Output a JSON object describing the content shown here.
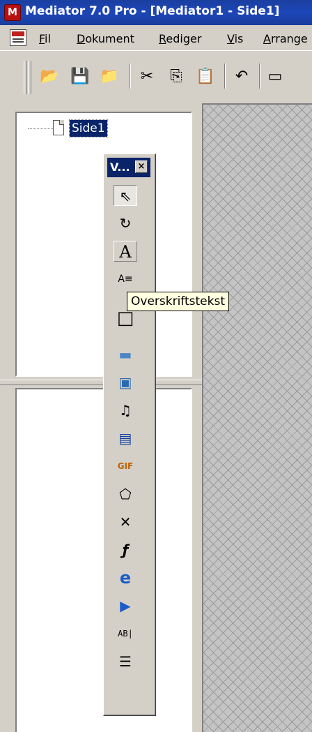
{
  "window": {
    "title": "Mediator 7.0 Pro - [Mediator1 - Side1]",
    "icon": "mediator-app-icon"
  },
  "menubar": {
    "items": [
      {
        "label": "Fil",
        "mnemonic": "F"
      },
      {
        "label": "Dokument",
        "mnemonic": "D"
      },
      {
        "label": "Rediger",
        "mnemonic": "R"
      },
      {
        "label": "Vis",
        "mnemonic": "V"
      },
      {
        "label": "Arrange",
        "mnemonic": "A"
      }
    ]
  },
  "toolbar": {
    "buttons": [
      "open-folder-icon",
      "save-icon",
      "folder-icon",
      "cut-icon",
      "copy-icon",
      "paste-icon",
      "undo-icon",
      "preview-icon"
    ]
  },
  "tree": {
    "nodes": [
      {
        "label": "Side1",
        "selected": true
      }
    ]
  },
  "toolbox": {
    "title": "V...",
    "close": "×",
    "tools": [
      {
        "name": "select-tool",
        "glyph": "⇖"
      },
      {
        "name": "rotate-tool",
        "glyph": "↻"
      },
      {
        "name": "text-tool",
        "glyph": "A"
      },
      {
        "name": "heading-text-tool",
        "glyph": "A≡"
      },
      {
        "name": "rectangle-tool",
        "glyph": "□"
      },
      {
        "name": "button-tool",
        "glyph": "▬"
      },
      {
        "name": "image-tool",
        "glyph": "▣"
      },
      {
        "name": "sound-tool",
        "glyph": "♫"
      },
      {
        "name": "video-tool",
        "glyph": "▤"
      },
      {
        "name": "gif-tool",
        "glyph": "GIF"
      },
      {
        "name": "polygon-tool",
        "glyph": "⬠"
      },
      {
        "name": "path-tool",
        "glyph": "✕"
      },
      {
        "name": "flash-tool",
        "glyph": "ƒ"
      },
      {
        "name": "web-browser-tool",
        "glyph": "e"
      },
      {
        "name": "media-player-tool",
        "glyph": "▶"
      },
      {
        "name": "input-field-tool",
        "glyph": "AB|"
      },
      {
        "name": "form-tool",
        "glyph": "☰"
      }
    ]
  },
  "tooltip": {
    "text": "Overskriftstekst"
  },
  "colors": {
    "titlebar": "#1c46b8",
    "selection": "#0a246a",
    "tooltip_bg": "#ffffe1",
    "chrome": "#d4d0c8"
  }
}
